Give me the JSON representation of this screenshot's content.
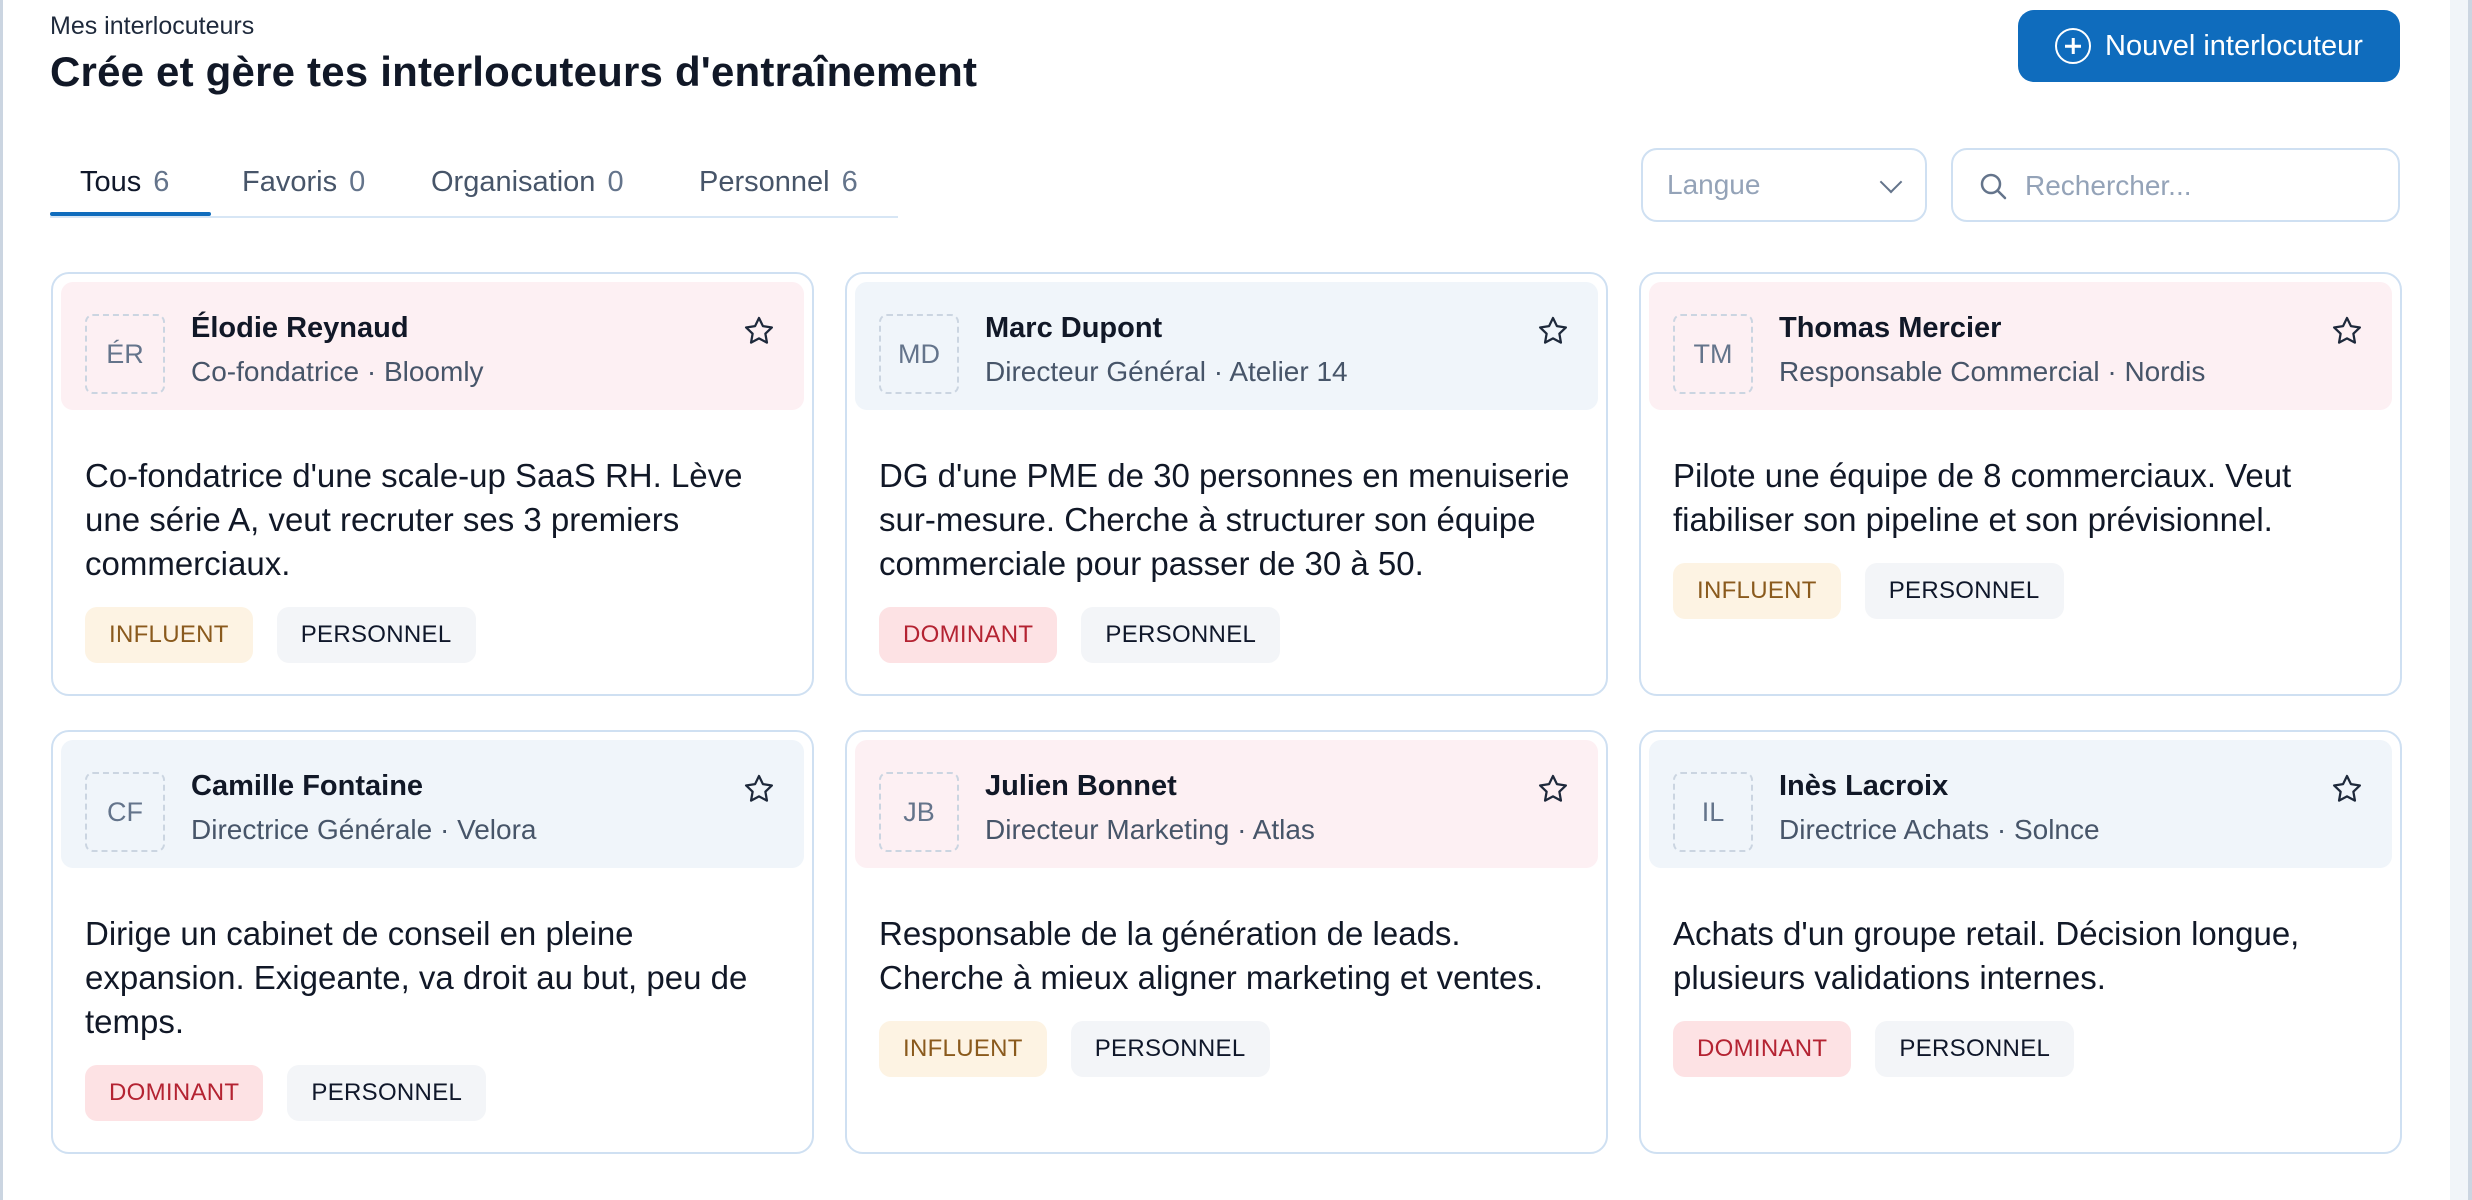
{
  "header": {
    "eyebrow": "Mes interlocuteurs",
    "title": "Crée et gère tes interlocuteurs d'entraînement",
    "new_button_label": "Nouvel interlocuteur"
  },
  "tabs": [
    {
      "label": "Tous",
      "count": "6",
      "active": true
    },
    {
      "label": "Favoris",
      "count": "0",
      "active": false
    },
    {
      "label": "Organisation",
      "count": "0",
      "active": false
    },
    {
      "label": "Personnel",
      "count": "6",
      "active": false
    }
  ],
  "filters": {
    "language_placeholder": "Langue",
    "search_placeholder": "Rechercher..."
  },
  "colors": {
    "accent": "#0f6cbd",
    "card_head_pink": "#fdf0f3",
    "card_head_blue": "#f0f5fa",
    "tag_influent_bg": "#fdf3e3",
    "tag_influent_text": "#8a5a1d",
    "tag_dominant_bg": "#fde2e4",
    "tag_dominant_text": "#b42332",
    "tag_personnel_bg": "#f3f5f8"
  },
  "cards": [
    {
      "initials": "ÉR",
      "name": "Élodie Reynaud",
      "role": "Co-fondatrice · Bloomly",
      "description": "Co-fondatrice d'une scale-up SaaS RH. Lève une série A, veut recruter ses 3 premiers commerciaux.",
      "tags": [
        "INFLUENT",
        "PERSONNEL"
      ],
      "head_color": "pink",
      "favorite": false
    },
    {
      "initials": "MD",
      "name": "Marc Dupont",
      "role": "Directeur Général · Atelier 14",
      "description": "DG d'une PME de 30 personnes en menuiserie sur-mesure. Cherche à structurer son équipe commerciale pour passer de 30 à 50.",
      "tags": [
        "DOMINANT",
        "PERSONNEL"
      ],
      "head_color": "blue",
      "favorite": false
    },
    {
      "initials": "TM",
      "name": "Thomas Mercier",
      "role": "Responsable Commercial · Nordis",
      "description": "Pilote une équipe de 8 commerciaux. Veut fiabiliser son pipeline et son prévisionnel.",
      "tags": [
        "INFLUENT",
        "PERSONNEL"
      ],
      "head_color": "pink",
      "favorite": false
    },
    {
      "initials": "CF",
      "name": "Camille Fontaine",
      "role": "Directrice Générale · Velora",
      "description": "Dirige un cabinet de conseil en pleine expansion. Exigeante, va droit au but, peu de temps.",
      "tags": [
        "DOMINANT",
        "PERSONNEL"
      ],
      "head_color": "blue",
      "favorite": false
    },
    {
      "initials": "JB",
      "name": "Julien Bonnet",
      "role": "Directeur Marketing · Atlas",
      "description": "Responsable de la génération de leads. Cherche à mieux aligner marketing et ventes.",
      "tags": [
        "INFLUENT",
        "PERSONNEL"
      ],
      "head_color": "pink",
      "favorite": false
    },
    {
      "initials": "IL",
      "name": "Inès Lacroix",
      "role": "Directrice Achats · Solnce",
      "description": "Achats d'un groupe retail. Décision longue, plusieurs validations internes.",
      "tags": [
        "DOMINANT",
        "PERSONNEL"
      ],
      "head_color": "blue",
      "favorite": false
    }
  ]
}
